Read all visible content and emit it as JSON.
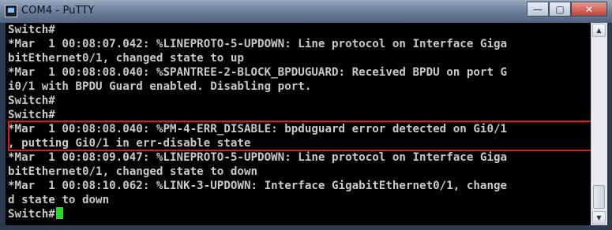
{
  "window": {
    "title": "COM4 - PuTTY",
    "buttons": {
      "minimize": "—",
      "maximize": "▢",
      "close": "✕"
    }
  },
  "terminal": {
    "lines": [
      "Switch#",
      "*Mar  1 00:08:07.042: %LINEPROTO-5-UPDOWN: Line protocol on Interface Giga",
      "bitEthernet0/1, changed state to up",
      "*Mar  1 00:08:08.040: %SPANTREE-2-BLOCK_BPDUGUARD: Received BPDU on port G",
      "i0/1 with BPDU Guard enabled. Disabling port.",
      "Switch#",
      "Switch#",
      "*Mar  1 00:08:08.040: %PM-4-ERR_DISABLE: bpduguard error detected on Gi0/1",
      ", putting Gi0/1 in err-disable state",
      "*Mar  1 00:08:09.047: %LINEPROTO-5-UPDOWN: Line protocol on Interface Giga",
      "bitEthernet0/1, changed state to down",
      "*Mar  1 00:08:10.062: %LINK-3-UPDOWN: Interface GigabitEthernet0/1, change",
      "d state to down",
      "Switch#"
    ],
    "highlighted_lines": [
      7,
      8
    ],
    "cursor_color": "#19e519",
    "highlight_color": "#d21f1f"
  },
  "scrollbar": {
    "up_arrow": "▲",
    "down_arrow": "▼"
  }
}
